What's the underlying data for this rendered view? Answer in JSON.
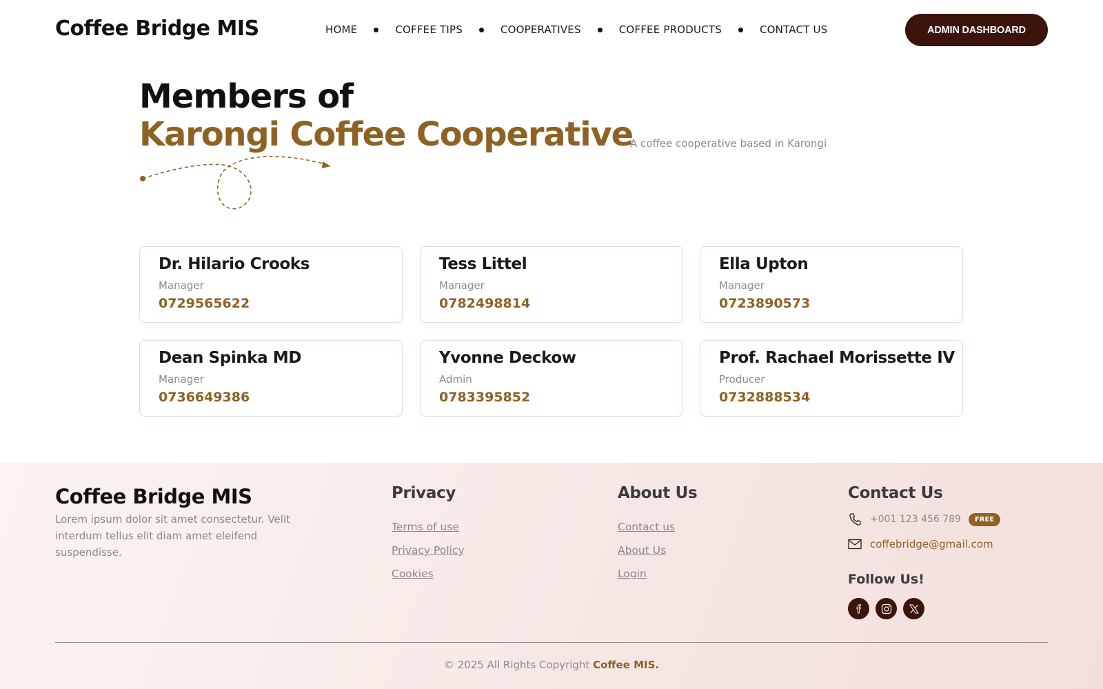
{
  "header": {
    "brand": "Coffee Bridge MIS",
    "nav": [
      "HOME",
      "COFFEE TIPS",
      "COOPERATIVES",
      "COFFEE PRODUCTS",
      "CONTACT US"
    ],
    "admin_button": "ADMIN DASHBOARD"
  },
  "hero": {
    "title_line1": "Members of",
    "title_line2": "Karongi Coffee Cooperative",
    "subtitle": "A coffee cooperative based in Karongi"
  },
  "members": [
    {
      "name": "Dr. Hilario Crooks",
      "role": "Manager",
      "phone": "0729565622"
    },
    {
      "name": "Tess Littel",
      "role": "Manager",
      "phone": "0782498814"
    },
    {
      "name": "Ella Upton",
      "role": "Manager",
      "phone": "0723890573"
    },
    {
      "name": "Dean Spinka MD",
      "role": "Manager",
      "phone": "0736649386"
    },
    {
      "name": "Yvonne Deckow",
      "role": "Admin",
      "phone": "0783395852"
    },
    {
      "name": "Prof. Rachael Morissette IV",
      "role": "Producer",
      "phone": "0732888534"
    }
  ],
  "footer": {
    "brand": "Coffee Bridge MIS",
    "description": "Lorem ipsum dolor sit amet consectetur. Velit interdum tellus elit diam amet eleifend suspendisse.",
    "privacy": {
      "title": "Privacy",
      "links": [
        "Terms of use",
        "Privacy Policy",
        "Cookies"
      ]
    },
    "about": {
      "title": "About Us",
      "links": [
        "Contact us",
        "About Us",
        "Login"
      ]
    },
    "contact": {
      "title": "Contact Us",
      "phone": "+001 123 456 789",
      "phone_badge": "FREE",
      "email": "coffebridge@gmail.com",
      "follow_title": "Follow Us!",
      "socials": [
        "facebook-icon",
        "instagram-icon",
        "x-icon"
      ]
    },
    "copyright_prefix": "© 2025 All Rights Copyright",
    "copyright_brand": "Coffee MIS."
  },
  "colors": {
    "accent": "#8e6224",
    "dark_brown": "#3b140c",
    "muted_text": "#8a8a8a",
    "card_border": "#ecd6d3"
  }
}
